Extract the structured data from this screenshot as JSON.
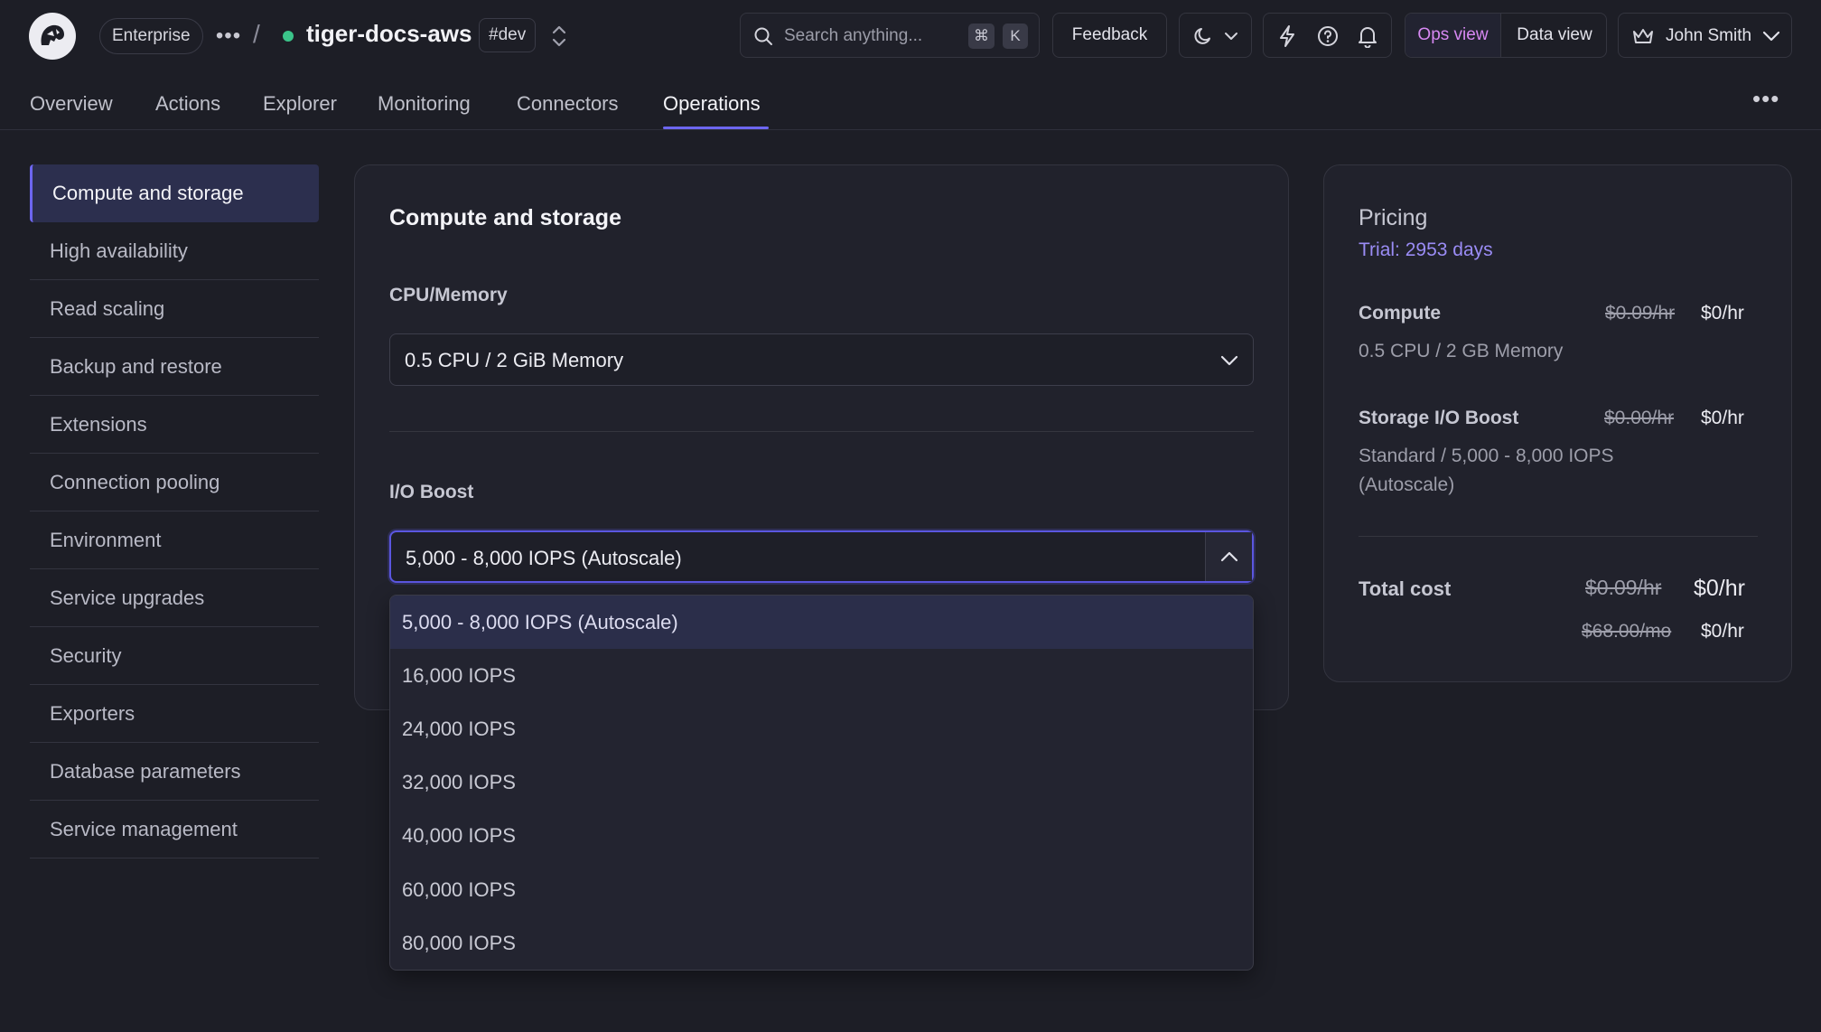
{
  "header": {
    "plan_badge": "Enterprise",
    "separator": "/",
    "service_name": "tiger-docs-aws",
    "env_tag": "#dev",
    "search_placeholder": "Search anything...",
    "search_shortcut_mod": "⌘",
    "search_shortcut_key": "K",
    "feedback_label": "Feedback",
    "ops_view_label": "Ops view",
    "data_view_label": "Data view",
    "user_name": "John Smith",
    "status_color": "#3bc48a",
    "ops_view_color": "#d688f2"
  },
  "tabs": [
    {
      "label": "Overview"
    },
    {
      "label": "Actions"
    },
    {
      "label": "Explorer"
    },
    {
      "label": "Monitoring"
    },
    {
      "label": "Connectors"
    },
    {
      "label": "Operations"
    }
  ],
  "active_tab": "Operations",
  "sidebar": {
    "items": [
      {
        "label": "Compute and storage"
      },
      {
        "label": "High availability"
      },
      {
        "label": "Read scaling"
      },
      {
        "label": "Backup and restore"
      },
      {
        "label": "Extensions"
      },
      {
        "label": "Connection pooling"
      },
      {
        "label": "Environment"
      },
      {
        "label": "Service upgrades"
      },
      {
        "label": "Security"
      },
      {
        "label": "Exporters"
      },
      {
        "label": "Database parameters"
      },
      {
        "label": "Service management"
      }
    ],
    "active": "Compute and storage"
  },
  "main": {
    "title": "Compute and storage",
    "cpu_label": "CPU/Memory",
    "cpu_value": "0.5 CPU / 2 GiB Memory",
    "io_label": "I/O Boost",
    "io_value": "5,000 - 8,000 IOPS (Autoscale)",
    "io_options": [
      {
        "label": "5,000 - 8,000 IOPS (Autoscale)"
      },
      {
        "label": "16,000 IOPS"
      },
      {
        "label": "24,000 IOPS"
      },
      {
        "label": "32,000 IOPS"
      },
      {
        "label": "40,000 IOPS"
      },
      {
        "label": "60,000 IOPS"
      },
      {
        "label": "80,000 IOPS"
      }
    ]
  },
  "pricing": {
    "title": "Pricing",
    "trial": "Trial: 2953 days",
    "compute_label": "Compute",
    "compute_old": "$0.09/hr",
    "compute_new": "$0/hr",
    "compute_desc": "0.5 CPU / 2 GB Memory",
    "storage_label": "Storage I/O Boost",
    "storage_old": "$0.00/hr",
    "storage_new": "$0/hr",
    "storage_desc": "Standard / 5,000 - 8,000 IOPS (Autoscale)",
    "total_label": "Total cost",
    "total_hr_old": "$0.09/hr",
    "total_hr_new": "$0/hr",
    "total_mo_old": "$68.00/mo",
    "total_mo_new": "$0/hr"
  },
  "accent_color": "#6d66f0"
}
